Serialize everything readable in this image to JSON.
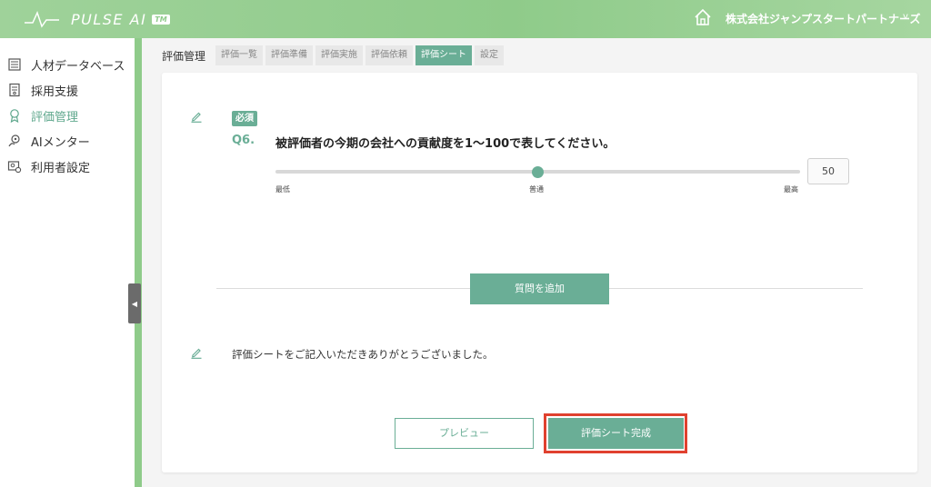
{
  "header": {
    "logo_text": "PULSE AI",
    "logo_tm": "TM",
    "company_name": "株式会社ジャンプスタートパートナーズ",
    "company_chevron": "v"
  },
  "sidebar": {
    "items": [
      {
        "label": "人材データベース",
        "icon": "database-icon",
        "active": false
      },
      {
        "label": "採用支援",
        "icon": "document-icon",
        "active": false
      },
      {
        "label": "評価管理",
        "icon": "award-icon",
        "active": true
      },
      {
        "label": "AIメンター",
        "icon": "mentor-icon",
        "active": false
      },
      {
        "label": "利用者設定",
        "icon": "user-settings-icon",
        "active": false
      }
    ],
    "collapse_glyph": "◀"
  },
  "breadcrumb": "評価管理",
  "tabs": [
    {
      "label": "評価一覧",
      "active": false
    },
    {
      "label": "評価準備",
      "active": false
    },
    {
      "label": "評価実施",
      "active": false
    },
    {
      "label": "評価依頼",
      "active": false
    },
    {
      "label": "評価シート",
      "active": true
    },
    {
      "label": "設定",
      "active": false
    }
  ],
  "question": {
    "badge": "必須",
    "number": "Q6.",
    "text": "被評価者の今期の会社への貢献度を1〜100で表してください。",
    "slider": {
      "min_label": "最低",
      "mid_label": "普通",
      "max_label": "最高",
      "value": "50",
      "fraction": 0.5
    }
  },
  "add_question_label": "質問を追加",
  "thanks_text": "評価シートをご記入いただきありがとうございました。",
  "buttons": {
    "preview": "プレビュー",
    "complete": "評価シート完成"
  },
  "colors": {
    "accent": "#6aae96",
    "header": "#8fcb8a",
    "highlight": "#e0412f"
  }
}
